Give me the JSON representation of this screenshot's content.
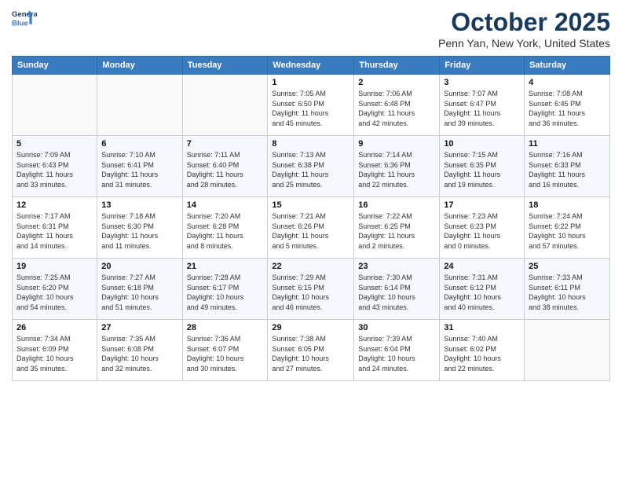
{
  "logo": {
    "line1": "General",
    "line2": "Blue"
  },
  "header": {
    "month": "October 2025",
    "location": "Penn Yan, New York, United States"
  },
  "weekdays": [
    "Sunday",
    "Monday",
    "Tuesday",
    "Wednesday",
    "Thursday",
    "Friday",
    "Saturday"
  ],
  "weeks": [
    [
      {
        "day": "",
        "info": ""
      },
      {
        "day": "",
        "info": ""
      },
      {
        "day": "",
        "info": ""
      },
      {
        "day": "1",
        "info": "Sunrise: 7:05 AM\nSunset: 6:50 PM\nDaylight: 11 hours\nand 45 minutes."
      },
      {
        "day": "2",
        "info": "Sunrise: 7:06 AM\nSunset: 6:48 PM\nDaylight: 11 hours\nand 42 minutes."
      },
      {
        "day": "3",
        "info": "Sunrise: 7:07 AM\nSunset: 6:47 PM\nDaylight: 11 hours\nand 39 minutes."
      },
      {
        "day": "4",
        "info": "Sunrise: 7:08 AM\nSunset: 6:45 PM\nDaylight: 11 hours\nand 36 minutes."
      }
    ],
    [
      {
        "day": "5",
        "info": "Sunrise: 7:09 AM\nSunset: 6:43 PM\nDaylight: 11 hours\nand 33 minutes."
      },
      {
        "day": "6",
        "info": "Sunrise: 7:10 AM\nSunset: 6:41 PM\nDaylight: 11 hours\nand 31 minutes."
      },
      {
        "day": "7",
        "info": "Sunrise: 7:11 AM\nSunset: 6:40 PM\nDaylight: 11 hours\nand 28 minutes."
      },
      {
        "day": "8",
        "info": "Sunrise: 7:13 AM\nSunset: 6:38 PM\nDaylight: 11 hours\nand 25 minutes."
      },
      {
        "day": "9",
        "info": "Sunrise: 7:14 AM\nSunset: 6:36 PM\nDaylight: 11 hours\nand 22 minutes."
      },
      {
        "day": "10",
        "info": "Sunrise: 7:15 AM\nSunset: 6:35 PM\nDaylight: 11 hours\nand 19 minutes."
      },
      {
        "day": "11",
        "info": "Sunrise: 7:16 AM\nSunset: 6:33 PM\nDaylight: 11 hours\nand 16 minutes."
      }
    ],
    [
      {
        "day": "12",
        "info": "Sunrise: 7:17 AM\nSunset: 6:31 PM\nDaylight: 11 hours\nand 14 minutes."
      },
      {
        "day": "13",
        "info": "Sunrise: 7:18 AM\nSunset: 6:30 PM\nDaylight: 11 hours\nand 11 minutes."
      },
      {
        "day": "14",
        "info": "Sunrise: 7:20 AM\nSunset: 6:28 PM\nDaylight: 11 hours\nand 8 minutes."
      },
      {
        "day": "15",
        "info": "Sunrise: 7:21 AM\nSunset: 6:26 PM\nDaylight: 11 hours\nand 5 minutes."
      },
      {
        "day": "16",
        "info": "Sunrise: 7:22 AM\nSunset: 6:25 PM\nDaylight: 11 hours\nand 2 minutes."
      },
      {
        "day": "17",
        "info": "Sunrise: 7:23 AM\nSunset: 6:23 PM\nDaylight: 11 hours\nand 0 minutes."
      },
      {
        "day": "18",
        "info": "Sunrise: 7:24 AM\nSunset: 6:22 PM\nDaylight: 10 hours\nand 57 minutes."
      }
    ],
    [
      {
        "day": "19",
        "info": "Sunrise: 7:25 AM\nSunset: 6:20 PM\nDaylight: 10 hours\nand 54 minutes."
      },
      {
        "day": "20",
        "info": "Sunrise: 7:27 AM\nSunset: 6:18 PM\nDaylight: 10 hours\nand 51 minutes."
      },
      {
        "day": "21",
        "info": "Sunrise: 7:28 AM\nSunset: 6:17 PM\nDaylight: 10 hours\nand 49 minutes."
      },
      {
        "day": "22",
        "info": "Sunrise: 7:29 AM\nSunset: 6:15 PM\nDaylight: 10 hours\nand 46 minutes."
      },
      {
        "day": "23",
        "info": "Sunrise: 7:30 AM\nSunset: 6:14 PM\nDaylight: 10 hours\nand 43 minutes."
      },
      {
        "day": "24",
        "info": "Sunrise: 7:31 AM\nSunset: 6:12 PM\nDaylight: 10 hours\nand 40 minutes."
      },
      {
        "day": "25",
        "info": "Sunrise: 7:33 AM\nSunset: 6:11 PM\nDaylight: 10 hours\nand 38 minutes."
      }
    ],
    [
      {
        "day": "26",
        "info": "Sunrise: 7:34 AM\nSunset: 6:09 PM\nDaylight: 10 hours\nand 35 minutes."
      },
      {
        "day": "27",
        "info": "Sunrise: 7:35 AM\nSunset: 6:08 PM\nDaylight: 10 hours\nand 32 minutes."
      },
      {
        "day": "28",
        "info": "Sunrise: 7:36 AM\nSunset: 6:07 PM\nDaylight: 10 hours\nand 30 minutes."
      },
      {
        "day": "29",
        "info": "Sunrise: 7:38 AM\nSunset: 6:05 PM\nDaylight: 10 hours\nand 27 minutes."
      },
      {
        "day": "30",
        "info": "Sunrise: 7:39 AM\nSunset: 6:04 PM\nDaylight: 10 hours\nand 24 minutes."
      },
      {
        "day": "31",
        "info": "Sunrise: 7:40 AM\nSunset: 6:02 PM\nDaylight: 10 hours\nand 22 minutes."
      },
      {
        "day": "",
        "info": ""
      }
    ]
  ]
}
